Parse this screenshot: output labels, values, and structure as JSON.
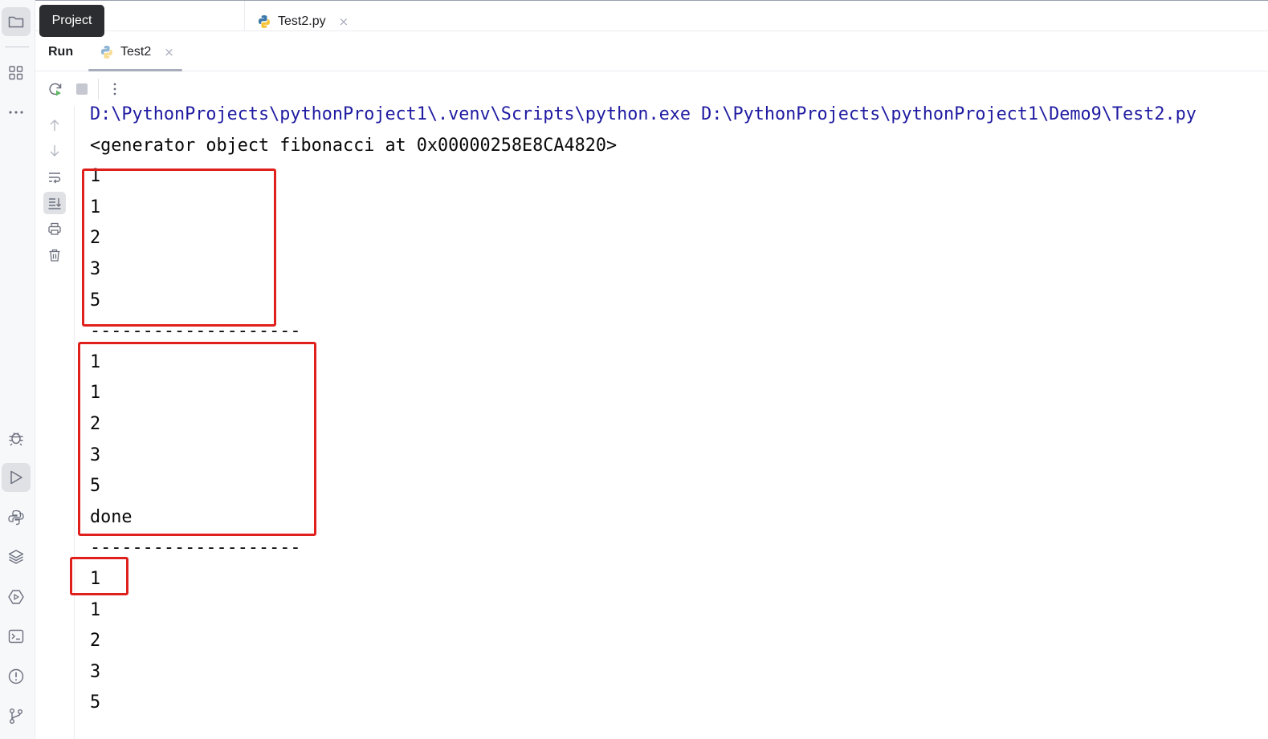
{
  "tooltip": {
    "text": "Project"
  },
  "stripe": {
    "top_buttons": [
      "folder-icon",
      "structure-icon",
      "more-icon"
    ],
    "bottom_buttons": [
      "debug-icon",
      "run-icon",
      "python-console-icon",
      "layers-icon",
      "services-icon",
      "terminal-icon",
      "problems-icon",
      "git-icon"
    ]
  },
  "editor": {
    "tabs": [
      {
        "label": "Test2.py",
        "icon": "python-file-icon",
        "close": "×"
      }
    ]
  },
  "run_window": {
    "title": "Run",
    "tab": {
      "label": "Test2",
      "icon": "python-run-icon",
      "close": "×"
    }
  },
  "toolbar": {
    "items": [
      "rerun-icon",
      "stop-icon",
      "more-options-icon"
    ]
  },
  "gutter": {
    "items": [
      "scroll-up-icon",
      "scroll-down-icon",
      "soft-wrap-icon",
      "scroll-to-end-icon",
      "print-icon",
      "clear-icon"
    ]
  },
  "console": {
    "lines": [
      "D:\\PythonProjects\\pythonProject1\\.venv\\Scripts\\python.exe D:\\PythonProjects\\pythonProject1\\Demo9\\Test2.py",
      "<generator object fibonacci at 0x00000258E8CA4820>",
      "1",
      "1",
      "2",
      "3",
      "5",
      "--------------------",
      "1",
      "1",
      "2",
      "3",
      "5",
      "done",
      "--------------------",
      "1",
      "1",
      "2",
      "3",
      "5"
    ]
  },
  "colors": {
    "command_text": "#1f1ba1",
    "output_text": "#080808",
    "highlight_box": "#e0201c",
    "tooltip_bg": "#2b2d30",
    "rerun_icon": "#5fb865"
  }
}
